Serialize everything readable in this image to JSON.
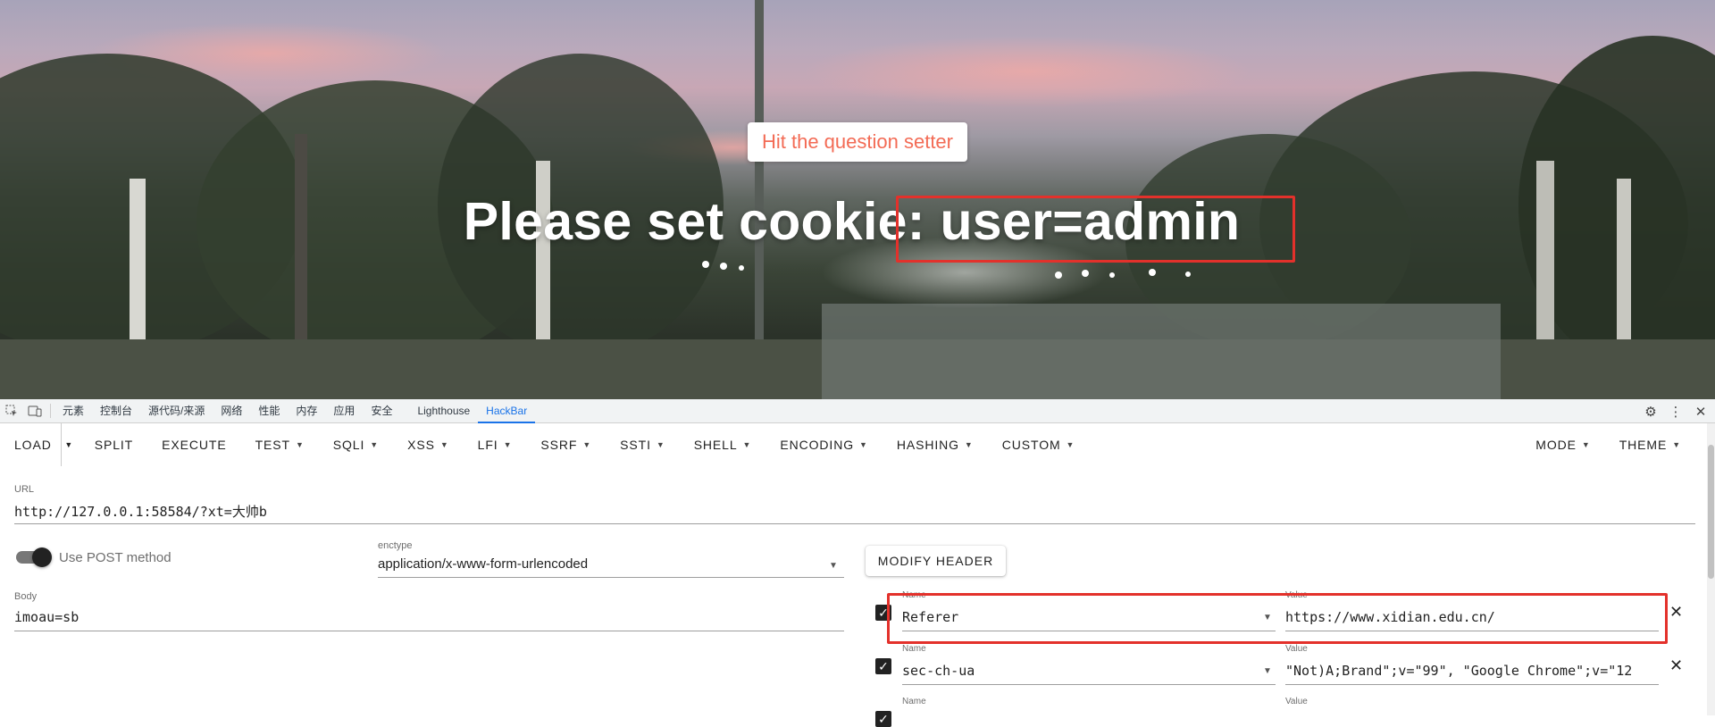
{
  "page": {
    "button_label": "Hit the question setter",
    "heading": "Please set cookie: user=admin"
  },
  "devtools": {
    "tabs": [
      "元素",
      "控制台",
      "源代码/来源",
      "网络",
      "性能",
      "内存",
      "应用",
      "安全",
      "Lighthouse",
      "HackBar"
    ],
    "active_tab": "HackBar"
  },
  "hackbar": {
    "toolbar": {
      "load": "LOAD",
      "items": [
        "SPLIT",
        "EXECUTE",
        "TEST",
        "SQLI",
        "XSS",
        "LFI",
        "SSRF",
        "SSTI",
        "SHELL",
        "ENCODING",
        "HASHING",
        "CUSTOM"
      ],
      "right_items": [
        "MODE",
        "THEME"
      ]
    },
    "url": {
      "label": "URL",
      "value": "http://127.0.0.1:58584/?xt=大帅b"
    },
    "post_toggle": {
      "label": "Use POST method",
      "on": true
    },
    "enctype": {
      "label": "enctype",
      "value": "application/x-www-form-urlencoded"
    },
    "body": {
      "label": "Body",
      "value": "imoau=sb"
    },
    "modify_header_label": "MODIFY HEADER",
    "headers": [
      {
        "name_label": "Name",
        "name": "Referer",
        "value_label": "Value",
        "value": "https://www.xidian.edu.cn/",
        "checked": true
      },
      {
        "name_label": "Name",
        "name": "sec-ch-ua",
        "value_label": "Value",
        "value": "\"Not)A;Brand\";v=\"99\", \"Google Chrome\";v=\"12",
        "checked": true
      },
      {
        "name_label": "Name",
        "name": "",
        "value_label": "Value",
        "value": "",
        "checked": true
      }
    ]
  },
  "colors": {
    "accent_blue": "#1a73e8",
    "highlight_red": "#e3312b",
    "page_button_text": "#f36b55"
  }
}
